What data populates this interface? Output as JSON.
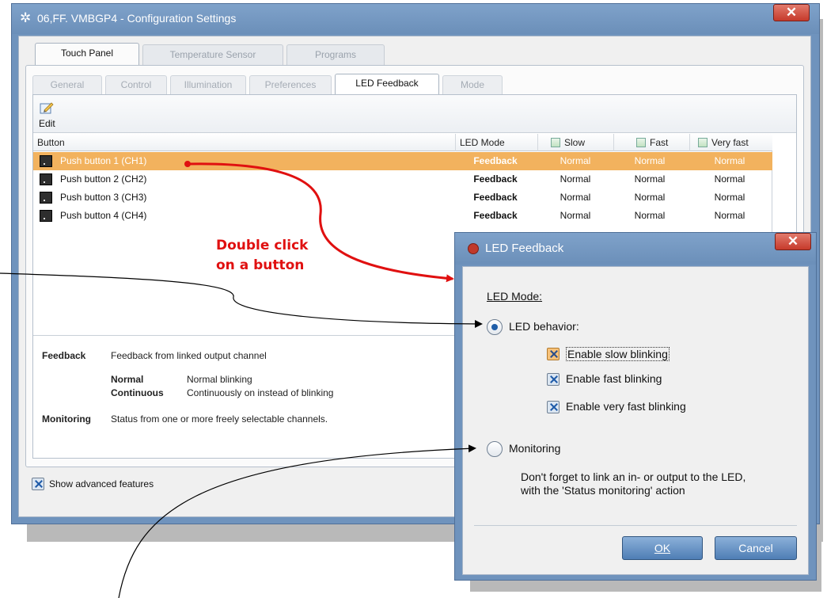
{
  "main_window": {
    "title": "06,FF. VMBGP4 - Configuration Settings",
    "close_glyph": "✕",
    "icon": "gear-icon",
    "tabs": [
      "Touch Panel",
      "Temperature Sensor",
      "Programs"
    ],
    "active_tab": "Touch Panel",
    "subtabs": [
      "General",
      "Control",
      "Illumination",
      "Preferences",
      "LED Feedback",
      "Mode"
    ],
    "active_subtab": "LED Feedback",
    "toolbar": {
      "edit_label": "Edit",
      "edit_icon": "edit-pencil-icon"
    },
    "grid": {
      "columns": [
        "Button",
        "LED Mode",
        "Slow",
        "Fast",
        "Very fast"
      ],
      "rows": [
        {
          "button": "Push button 1 (CH1)",
          "led_mode": "Feedback",
          "slow": "Normal",
          "fast": "Normal",
          "very_fast": "Normal",
          "selected": true
        },
        {
          "button": "Push button 2 (CH2)",
          "led_mode": "Feedback",
          "slow": "Normal",
          "fast": "Normal",
          "very_fast": "Normal",
          "selected": false
        },
        {
          "button": "Push button 3 (CH3)",
          "led_mode": "Feedback",
          "slow": "Normal",
          "fast": "Normal",
          "very_fast": "Normal",
          "selected": false
        },
        {
          "button": "Push button 4 (CH4)",
          "led_mode": "Feedback",
          "slow": "Normal",
          "fast": "Normal",
          "very_fast": "Normal",
          "selected": false
        }
      ]
    },
    "legend": {
      "feedback_title": "Feedback",
      "feedback_desc": "Feedback from linked output channel",
      "normal_title": "Normal",
      "normal_desc": "Normal blinking",
      "continuous_title": "Continuous",
      "continuous_desc": "Continuously on instead of blinking",
      "monitoring_title": "Monitoring",
      "monitoring_desc": "Status from one or more freely selectable channels."
    },
    "show_advanced": {
      "label": "Show advanced features",
      "checked": true
    }
  },
  "led_dialog": {
    "title": "LED Feedback",
    "close_glyph": "✕",
    "section_label": "LED Mode:",
    "option_behavior": "LED behavior:",
    "option_behavior_checked": true,
    "check_slow": "Enable slow blinking",
    "check_fast": "Enable fast blinking",
    "check_very_fast": "Enable very fast blinking",
    "option_monitoring": "Monitoring",
    "monitoring_hint_1": "Don't forget to link an in- or output to the LED,",
    "monitoring_hint_2": "with the 'Status monitoring' action",
    "ok_label": "OK",
    "cancel_label": "Cancel"
  },
  "annotation": {
    "line1": "Double click",
    "line2": "on a button",
    "color": "#e01010"
  },
  "colors": {
    "titlebar": "#6f93bd",
    "selection": "#f2b25e",
    "close": "#c63a2b"
  }
}
